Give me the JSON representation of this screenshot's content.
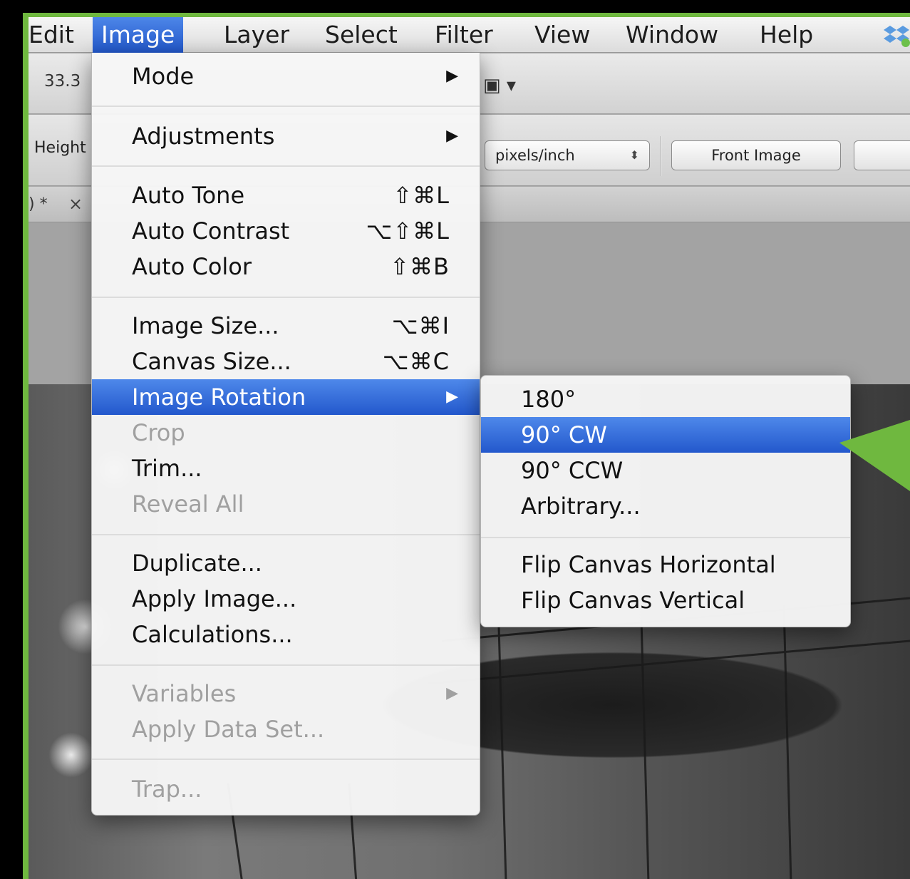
{
  "menubar": {
    "items": [
      "Edit",
      "Image",
      "Layer",
      "Select",
      "Filter",
      "View",
      "Window",
      "Help"
    ],
    "active": "Image",
    "status_icon": "dropbox-icon"
  },
  "options_bar": {
    "zoom_value": "33.3",
    "height_label": "Height",
    "frame_icon": "frame-icon",
    "units_select": "pixels/inch",
    "front_image_button": "Front Image"
  },
  "document_tab": {
    "label": ") *",
    "close": "×"
  },
  "image_menu": {
    "items": [
      {
        "label": "Mode",
        "shortcut": "",
        "submenu": true
      },
      {
        "label": "Adjustments",
        "shortcut": "",
        "submenu": true
      },
      {
        "label": "Auto Tone",
        "shortcut": "⇧⌘L"
      },
      {
        "label": "Auto Contrast",
        "shortcut": "⌥⇧⌘L"
      },
      {
        "label": "Auto Color",
        "shortcut": "⇧⌘B"
      },
      {
        "label": "Image Size...",
        "shortcut": "⌥⌘I"
      },
      {
        "label": "Canvas Size...",
        "shortcut": "⌥⌘C"
      },
      {
        "label": "Image Rotation",
        "shortcut": "",
        "submenu": true,
        "highlighted": true
      },
      {
        "label": "Crop",
        "shortcut": "",
        "disabled": true
      },
      {
        "label": "Trim...",
        "shortcut": ""
      },
      {
        "label": "Reveal All",
        "shortcut": "",
        "disabled": true
      },
      {
        "label": "Duplicate...",
        "shortcut": ""
      },
      {
        "label": "Apply Image...",
        "shortcut": ""
      },
      {
        "label": "Calculations...",
        "shortcut": ""
      },
      {
        "label": "Variables",
        "shortcut": "",
        "submenu": true,
        "disabled": true
      },
      {
        "label": "Apply Data Set...",
        "shortcut": "",
        "disabled": true
      },
      {
        "label": "Trap...",
        "shortcut": "",
        "disabled": true
      }
    ],
    "submenu_arrow": "▶"
  },
  "rotation_submenu": {
    "items": [
      {
        "label": "180°"
      },
      {
        "label": "90° CW",
        "highlighted": true
      },
      {
        "label": "90° CCW"
      },
      {
        "label": "Arbitrary..."
      },
      {
        "label": "Flip Canvas Horizontal"
      },
      {
        "label": "Flip Canvas Vertical"
      }
    ]
  },
  "colors": {
    "border_green": "#6fb83f",
    "highlight_blue": "#2f66d8",
    "callout_green": "#6fb83f"
  }
}
